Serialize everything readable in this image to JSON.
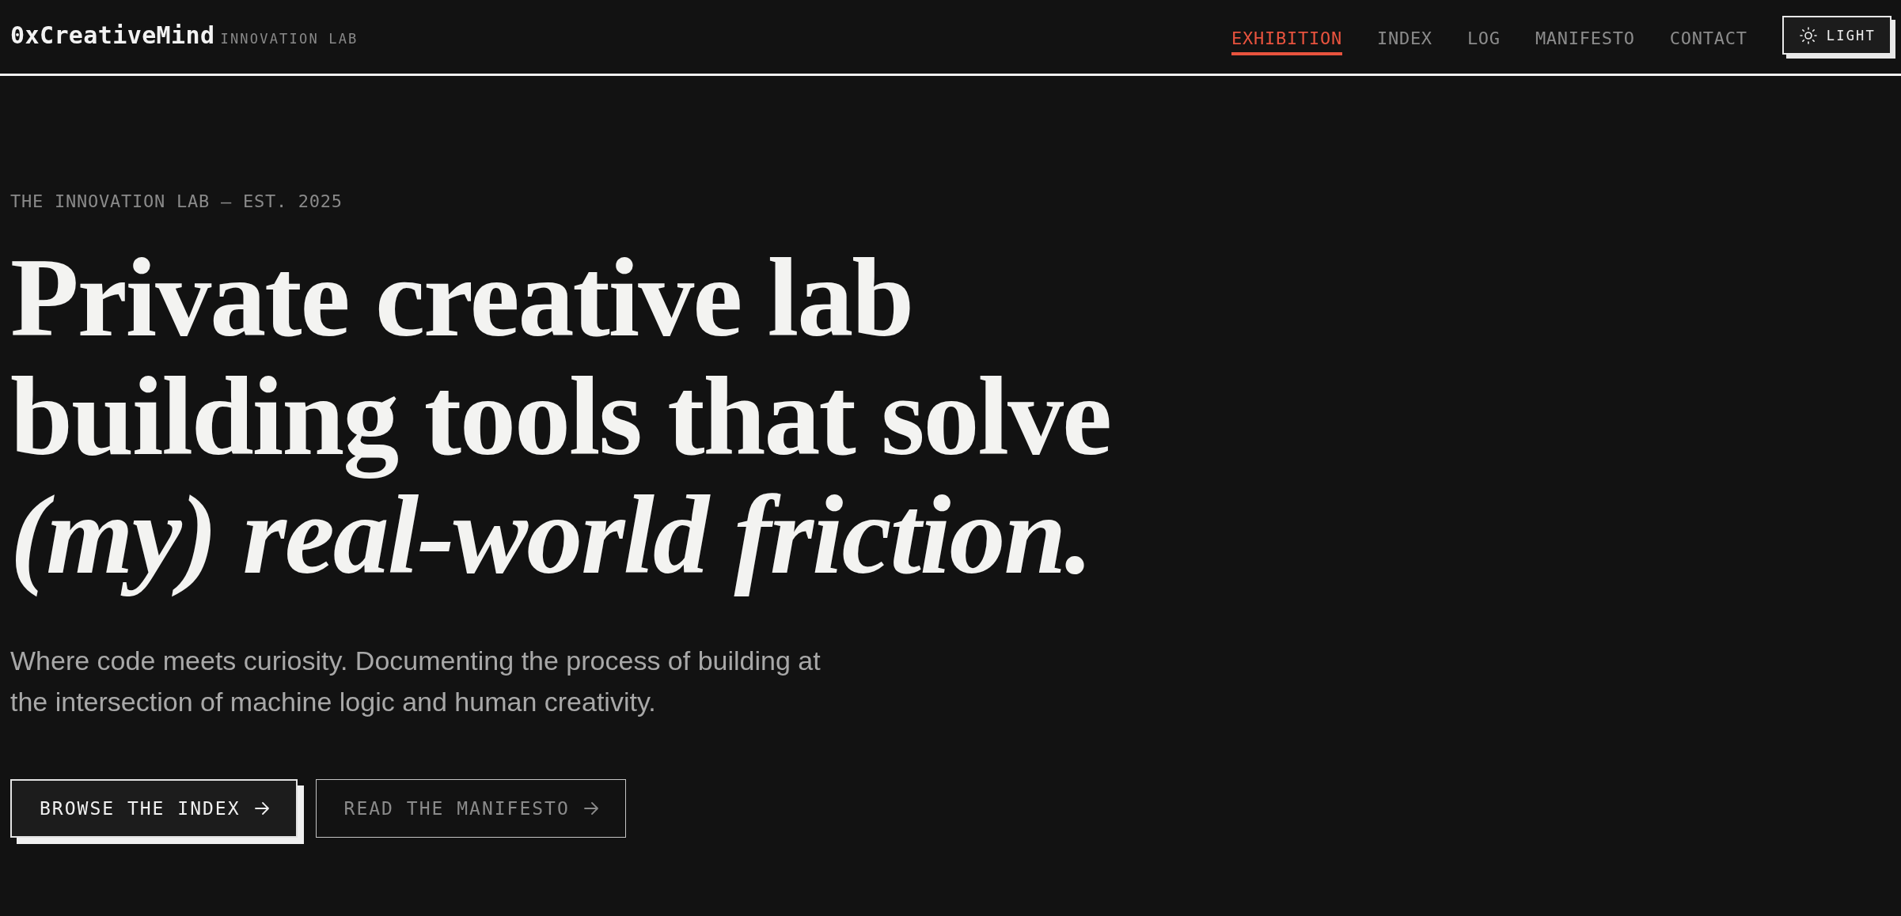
{
  "header": {
    "logo": "0xCreativeMind",
    "tagline": "INNOVATION LAB",
    "nav": [
      {
        "label": "EXHIBITION",
        "selected": true
      },
      {
        "label": "INDEX",
        "selected": false
      },
      {
        "label": "LOG",
        "selected": false
      },
      {
        "label": "MANIFESTO",
        "selected": false
      },
      {
        "label": "CONTACT",
        "selected": false
      }
    ],
    "theme_toggle": {
      "label": "LIGHT"
    }
  },
  "hero": {
    "eyebrow": "THE INNOVATION LAB — EST. 2025",
    "headline": "Private creative lab building tools that solve *(my) real-world friction.*",
    "intro": "Where code meets curiosity. Documenting the process of building at the intersection of machine logic and human creativity.",
    "actions": [
      {
        "label": "BROWSE THE INDEX",
        "kind": "primary"
      },
      {
        "label": "READ THE MANIFESTO",
        "kind": "secondary"
      }
    ]
  }
}
